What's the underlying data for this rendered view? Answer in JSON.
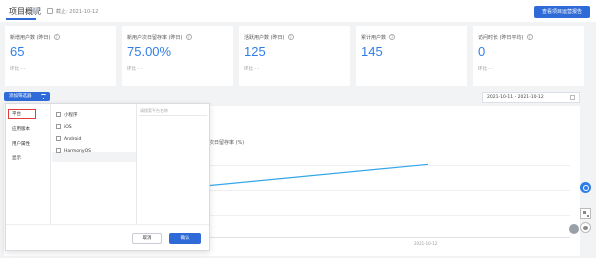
{
  "header": {
    "title": "项目概况",
    "as_of": "截止: 2021-10-12",
    "action_button": "查看项目运营报告"
  },
  "cards": [
    {
      "label": "新增用户数 (昨日)",
      "value": "65",
      "compare": "环比 - -"
    },
    {
      "label": "新用户次日留存率 (昨日)",
      "value": "75.00%",
      "compare": "环比 - -"
    },
    {
      "label": "活跃用户数 (昨日)",
      "value": "125",
      "compare": "环比 - -"
    },
    {
      "label": "累计用户数",
      "value": "145",
      "compare": ""
    },
    {
      "label": "访问时长 (昨日平均)",
      "value": "0",
      "compare": "环比 - -"
    }
  ],
  "toolbar": {
    "filter_button": "添加筛选器",
    "date_range": "2021-10-11 - 2021-10-12"
  },
  "chart": {
    "metric_title": "次日留存率 (%)",
    "x_tick": "2021-10-12"
  },
  "chart_data": {
    "type": "line",
    "x": [
      "2021-10-11",
      "2021-10-12"
    ],
    "series": [
      {
        "values": [
          40,
          75
        ]
      }
    ],
    "ylim": [
      0,
      100
    ]
  },
  "filter_popup": {
    "categories": [
      "平台",
      "应用版本",
      "用户属性",
      "显示"
    ],
    "search_placeholder": "请搜索平台名称",
    "options": [
      "小程序",
      "iOS",
      "Android",
      "HarmonyOS"
    ],
    "cancel": "取消",
    "confirm": "确认"
  },
  "colors": {
    "primary": "#2f6bd8",
    "value_blue": "#2f7ee8",
    "line": "#35a7ea",
    "selection_red": "#e23b3b"
  }
}
